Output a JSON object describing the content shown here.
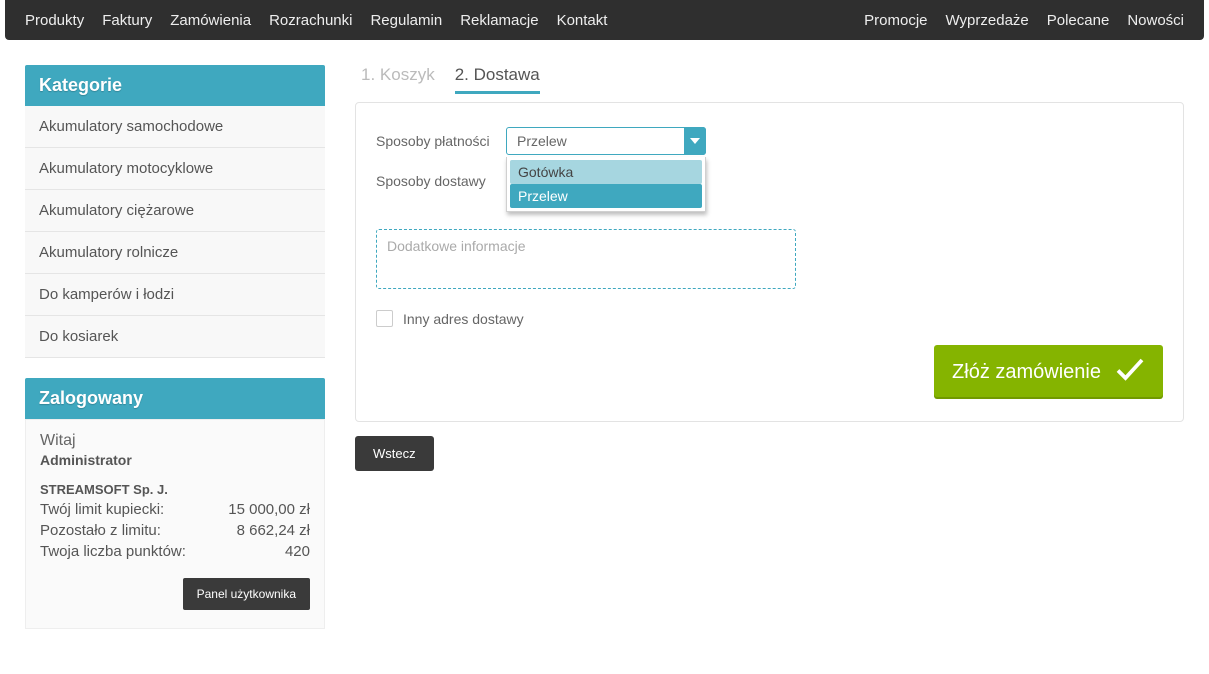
{
  "topnav_left": [
    "Produkty",
    "Faktury",
    "Zamówienia",
    "Rozrachunki",
    "Regulamin",
    "Reklamacje",
    "Kontakt"
  ],
  "topnav_right": [
    "Promocje",
    "Wyprzedaże",
    "Polecane",
    "Nowości"
  ],
  "sidebar": {
    "categories_header": "Kategorie",
    "categories": [
      "Akumulatory samochodowe",
      "Akumulatory motocyklowe",
      "Akumulatory ciężarowe",
      "Akumulatory rolnicze",
      "Do kamperów i łodzi",
      "Do kosiarek"
    ],
    "logged_header": "Zalogowany",
    "logged": {
      "greeting": "Witaj",
      "role": "Administrator",
      "company": "STREAMSOFT Sp. J.",
      "limit_label": "Twój limit kupiecki:",
      "limit_value": "15 000,00 zł",
      "remaining_label": "Pozostało z limitu:",
      "remaining_value": "8 662,24 zł",
      "points_label": "Twoja liczba punktów:",
      "points_value": "420",
      "panel_btn": "Panel użytkownika"
    }
  },
  "steps": {
    "step1": "1. Koszyk",
    "step2": "2. Dostawa"
  },
  "form": {
    "payment_label": "Sposoby płatności",
    "payment_selected": "Przelew",
    "payment_options": [
      "Gotówka",
      "Przelew"
    ],
    "delivery_label": "Sposoby dostawy",
    "info_placeholder": "Dodatkowe informacje",
    "other_address_label": "Inny adres dostawy",
    "submit_label": "Złóż zamówienie",
    "back_label": "Wstecz"
  }
}
